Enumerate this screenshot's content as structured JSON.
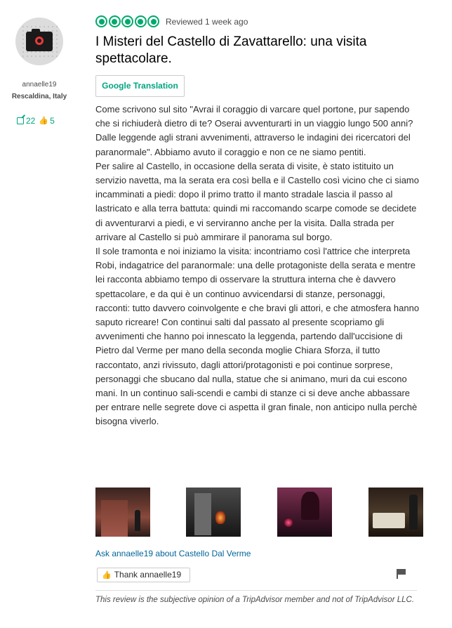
{
  "reviewer": {
    "username": "annaelle19",
    "location": "Rescaldina, Italy",
    "review_count": "22",
    "helpful_votes": "5"
  },
  "review": {
    "rating_bubbles": 5,
    "reviewed_text": "Reviewed 1 week ago",
    "title": "I Misteri del Castello di Zavattarello: una visita spettacolare.",
    "translate_button": "Google Translation",
    "body": "Come scrivono sul sito \"Avrai il coraggio di varcare quel portone, pur sapendo che si richiuderà dietro di te? Oserai avventurarti in un viaggio lungo 500 anni?\nDalle leggende agli strani avvenimenti, attraverso le indagini dei ricercatori del paranormale\". Abbiamo avuto il coraggio e non ce ne siamo pentiti.\nPer salire al Castello, in occasione della serata di visite, è stato istituito un servizio navetta, ma la serata era così bella e il Castello così vicino che ci siamo incamminati a piedi: dopo il primo tratto il manto stradale lascia il passo al lastricato e alla terra battuta: quindi mi raccomando scarpe comode se decidete di avventurarvi a piedi, e vi serviranno anche per la visita. Dalla strada per arrivare al Castello si può ammirare il panorama sul borgo.\nIl sole tramonta e noi iniziamo la visita: incontriamo così l'attrice che interpreta Robi, indagatrice del paranormale: una delle protagoniste della serata e mentre lei racconta abbiamo tempo di osservare la struttura interna che è davvero spettacolare, e da qui è un continuo avvicendarsi di stanze, personaggi, racconti: tutto davvero coinvolgente e che bravi gli attori, e che atmosfera hanno saputo ricreare! Con continui salti dal passato al presente scopriamo gli avvenimenti che hanno poi innescato la leggenda, partendo dall'uccisione di Pietro dal Verme per mano della seconda moglie Chiara Sforza, il tutto raccontato, anzi rivissuto, dagli attori/protagonisti e poi continue sorprese, personaggi che sbucano dal nulla, statue che si animano, muri da cui escono mani. In un continuo sali-scendi e cambi di stanze ci si deve anche abbassare per entrare nelle segrete dove ci aspetta il gran finale, non anticipo nulla perchè bisogna viverlo.",
    "ask_link": "Ask annaelle19 about Castello Dal Verme",
    "thank_button": "Thank annaelle19",
    "disclaimer": "This review is the subjective opinion of a TripAdvisor member and not of TripAdvisor LLC."
  },
  "colors": {
    "accent": "#00a680",
    "bubble": "#00aa6c",
    "link": "#006699"
  },
  "icons": [
    "camera-avatar-icon",
    "review-count-icon",
    "thumbs-up-icon",
    "flag-icon"
  ]
}
